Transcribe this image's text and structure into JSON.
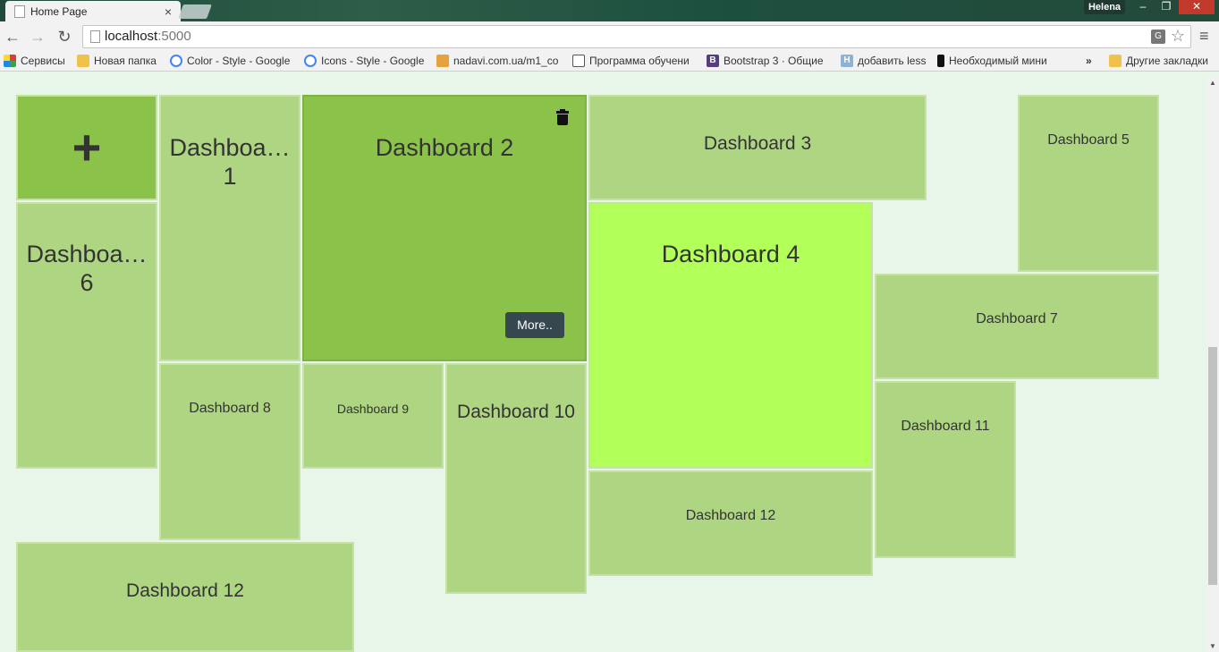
{
  "browser": {
    "tab_title": "Home Page",
    "tab_close": "×",
    "profile_name": "Helena",
    "window_minimize": "–",
    "window_restore": "❐",
    "window_close": "✕",
    "back": "←",
    "forward": "→",
    "reload": "↻",
    "url_host": "localhost",
    "url_port": ":5000",
    "star": "☆",
    "menu": "≡"
  },
  "bookmarks": {
    "items": [
      {
        "label": "Сервисы",
        "icon": "apps-icon",
        "color": "#e57373"
      },
      {
        "label": "Новая папка",
        "icon": "folder-icon",
        "color": "#f0c24b"
      },
      {
        "label": "Color - Style - Google",
        "icon": "google-icon",
        "color": "#4285f4"
      },
      {
        "label": "Icons - Style - Google",
        "icon": "google-icon",
        "color": "#4285f4"
      },
      {
        "label": "nadavi.com.ua/m1_co",
        "icon": "cart-icon",
        "color": "#e6a23c"
      },
      {
        "label": "Программа обучени",
        "icon": "shield-icon",
        "color": "#555555"
      },
      {
        "label": "Bootstrap 3 · Общие",
        "icon": "bootstrap-icon",
        "color": "#563d7c"
      },
      {
        "label": "добавить less",
        "icon": "h-icon",
        "color": "#8fb1d3"
      },
      {
        "label": "Необходимый мини",
        "icon": "bookmark-icon",
        "color": "#111111"
      }
    ],
    "overflow": "»",
    "other_label": "Другие закладки"
  },
  "dashboard": {
    "add_symbol": "+",
    "more_label": "More..",
    "tiles": [
      {
        "label": "Dashboa… 1",
        "state": "normal"
      },
      {
        "label": "Dashboard 2",
        "state": "selected"
      },
      {
        "label": "Dashboard 3",
        "state": "normal"
      },
      {
        "label": "Dashboard 4",
        "state": "highlight"
      },
      {
        "label": "Dashboard 5",
        "state": "normal"
      },
      {
        "label": "Dashboa… 6",
        "state": "normal"
      },
      {
        "label": "Dashboard 7",
        "state": "normal"
      },
      {
        "label": "Dashboard 8",
        "state": "normal"
      },
      {
        "label": "Dashboard 9",
        "state": "normal"
      },
      {
        "label": "Dashboard 10",
        "state": "normal"
      },
      {
        "label": "Dashboard 11",
        "state": "normal"
      },
      {
        "label": "Dashboard 12",
        "state": "normal"
      },
      {
        "label": "Dashboard 12",
        "state": "normal"
      }
    ]
  },
  "colors": {
    "tile": "#aed581",
    "selected": "#8bc34a",
    "highlight": "#b2ff59",
    "page_bg": "#e8f5e9",
    "button": "#37474f"
  }
}
